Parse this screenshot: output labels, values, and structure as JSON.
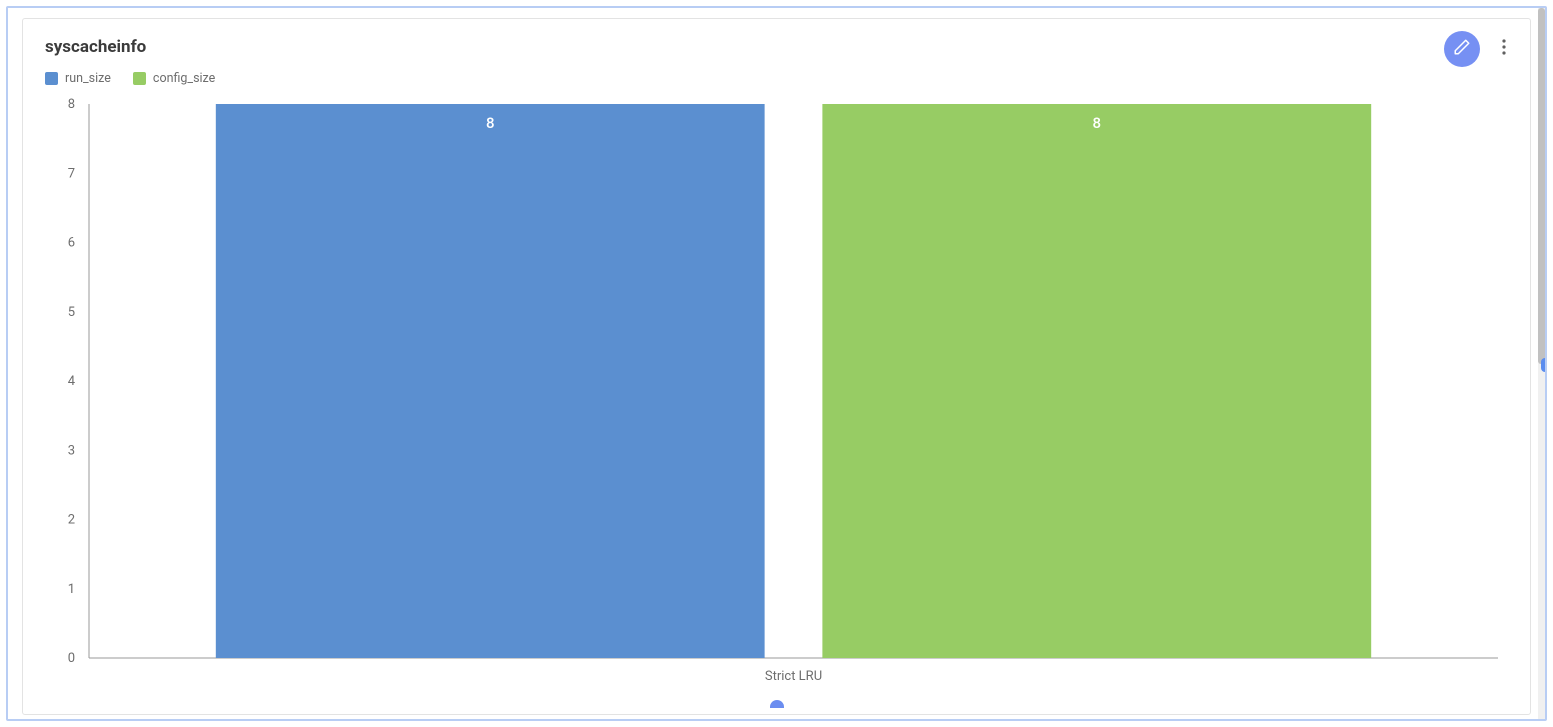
{
  "title": "syscacheinfo",
  "colors": {
    "run_size": "#5b8fd0",
    "config_size": "#97cc64",
    "accent": "#7690f3"
  },
  "legend": [
    {
      "key": "run_size",
      "label": "run_size"
    },
    {
      "key": "config_size",
      "label": "config_size"
    }
  ],
  "chart_data": {
    "type": "bar",
    "categories": [
      "Strict LRU"
    ],
    "series": [
      {
        "name": "run_size",
        "values": [
          8
        ]
      },
      {
        "name": "config_size",
        "values": [
          8
        ]
      }
    ],
    "ylim": [
      0,
      8
    ],
    "yticks": [
      0,
      1,
      2,
      3,
      4,
      5,
      6,
      7,
      8
    ],
    "xlabel": "",
    "ylabel": "",
    "title": ""
  }
}
